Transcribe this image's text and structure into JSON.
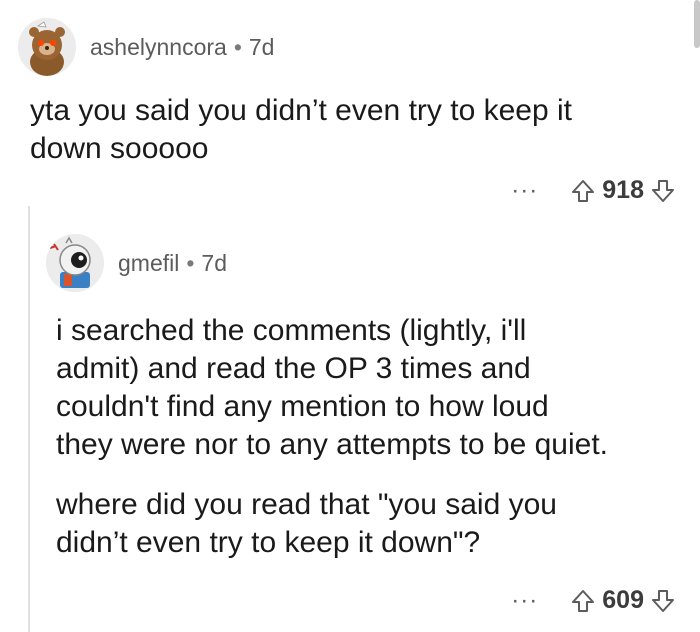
{
  "comments": [
    {
      "username": "ashelynncora",
      "separator": "•",
      "time": "7d",
      "text_lines": [
        "yta you said you didn’t even try to keep it",
        "down sooooo"
      ],
      "more_label": "···",
      "score": "918"
    },
    {
      "username": "gmefil",
      "separator": "•",
      "time": "7d",
      "paragraph1": [
        "i searched the comments (lightly, i'll",
        "admit) and read the OP 3 times and",
        "couldn't find any mention to how loud",
        "they were nor to any attempts to be quiet."
      ],
      "paragraph2": [
        "where did you read that \"you said you",
        "didn’t even try to keep it down\"?"
      ],
      "more_label": "···",
      "score": "609"
    }
  ],
  "icons": {
    "upvote": "upvote-arrow-icon",
    "downvote": "downvote-arrow-icon",
    "avatar1": "snoo-bear-avatar",
    "avatar2": "snoo-robot-avatar"
  },
  "colors": {
    "text": "#1a1a1b",
    "meta": "#5c5c5c",
    "thread": "#e0e0e0"
  }
}
